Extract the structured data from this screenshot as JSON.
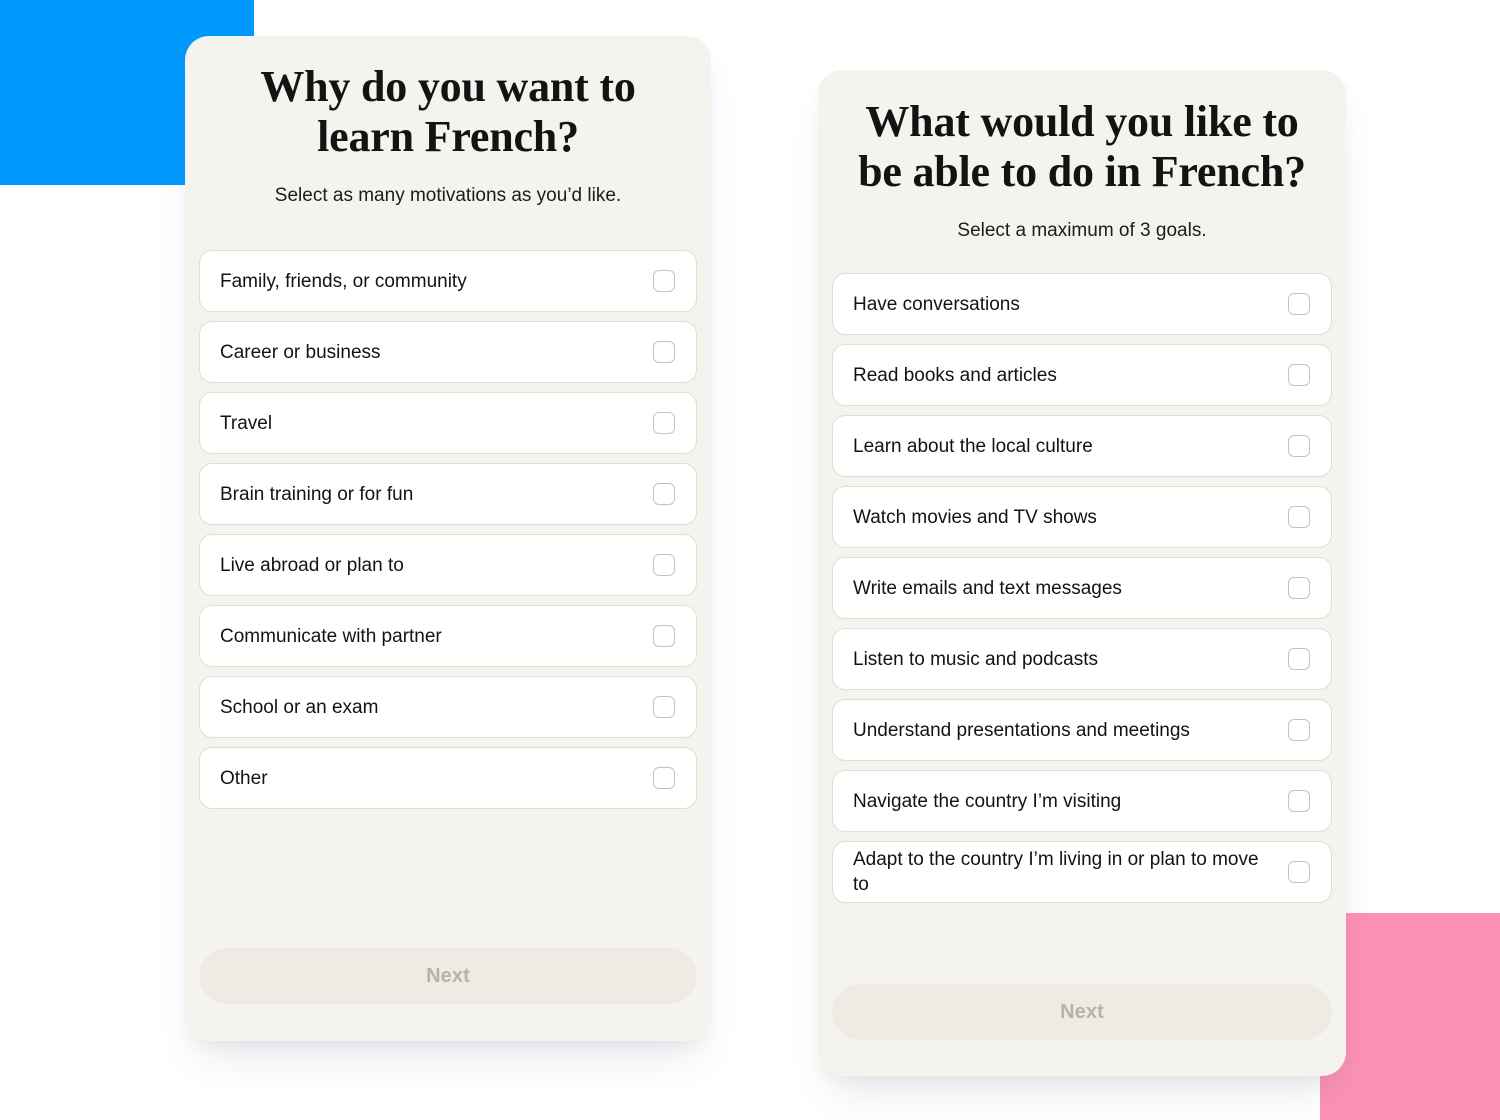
{
  "decor": {
    "blue_color": "#0099FF",
    "pink_color": "#FC91B4"
  },
  "screens": [
    {
      "id": "motivations",
      "title": "Why do you want to learn French?",
      "subtitle": "Select as many motivations as you’d like.",
      "options": [
        "Family, friends, or community",
        "Career or business",
        "Travel",
        "Brain training or for fun",
        "Live abroad or plan to",
        "Communicate with partner",
        "School or an exam",
        "Other"
      ],
      "next_label": "Next"
    },
    {
      "id": "goals",
      "title": "What would you like to be able to do in French?",
      "subtitle": "Select a maximum of 3 goals.",
      "options": [
        "Have conversations",
        "Read books and articles",
        "Learn about the local culture",
        "Watch movies and TV shows",
        "Write emails and text messages",
        "Listen to music and podcasts",
        "Understand presentations and meetings",
        "Navigate the country I’m visiting",
        "Adapt to the country I’m living in or plan to move to"
      ],
      "next_label": "Next"
    }
  ]
}
